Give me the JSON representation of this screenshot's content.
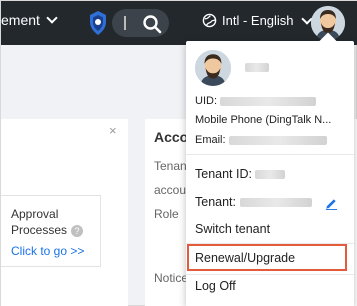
{
  "topbar": {
    "nav_label": "ement",
    "search_value": "I",
    "language_label": "Intl - English"
  },
  "left_card": {
    "close_glyph": "×",
    "approval_title_1": "Approval",
    "approval_title_2": "Processes",
    "approval_link": "Click to go >>"
  },
  "right_card": {
    "title": "Acco",
    "row_tenant": "Tenan",
    "row_account": "accou",
    "row_role": "Role",
    "row_notice": "Notice"
  },
  "dropdown": {
    "uid_label": "UID:",
    "mobile_label": "Mobile Phone (DingTalk N...",
    "email_label": "Email:",
    "tenant_id_label": "Tenant ID:",
    "tenant_label": "Tenant:",
    "items": {
      "switch_tenant": "Switch tenant",
      "renewal_upgrade": "Renewal/Upgrade",
      "log_off": "Log Off"
    }
  },
  "colors": {
    "topbar": "#23282d",
    "link": "#1a73e8",
    "highlight": "#e35b3c"
  }
}
